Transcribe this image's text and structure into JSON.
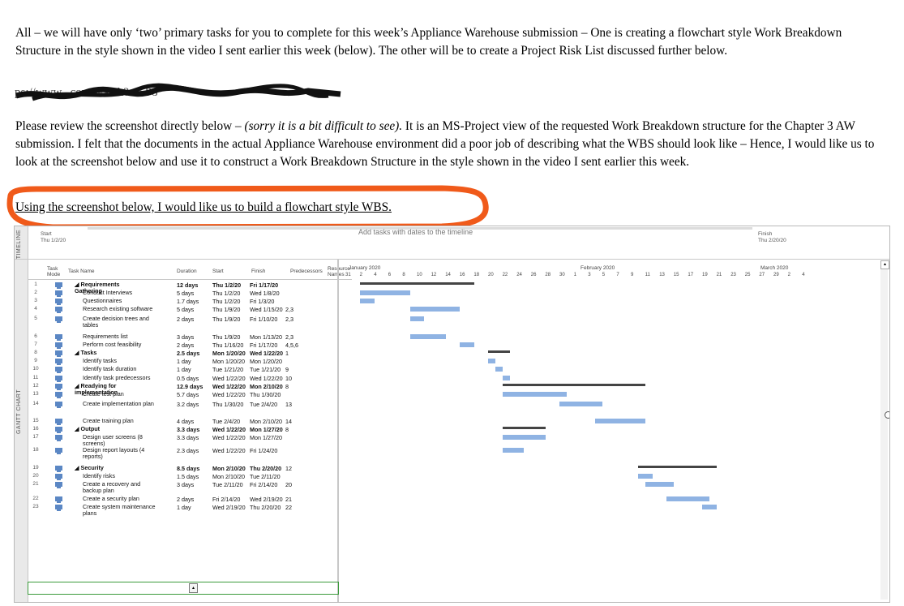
{
  "paragraphs": {
    "p1": "All – we will have only ‘two’ primary tasks for you to complete for this week’s Appliance Warehouse submission – One is creating a flowchart style Work Breakdown Structure in the style shown in the video I sent earlier this week (below).  The other will be to create a Project Risk List discussed further below.",
    "p2_a": "Please review the screenshot directly below – ",
    "p2_italic": "(sorry it is a bit difficult to see).",
    "p2_b": "  It is an MS-Project view of the requested Work Breakdown structure for the Chapter 3 AW submission.  I felt that the documents in the actual Appliance Warehouse environment did a poor job of describing what the WBS should look like – Hence, I would like us to look at the screenshot below and use it to construct a Work Breakdown Structure in the style shown in the video I sent earlier this week.",
    "p3": "Using the screenshot below, I would like us to build a flowchart style WBS.",
    "redacted_fragment": "ps://www.           .com/watch?v=        P8"
  },
  "project": {
    "timeline_tab": "TIMELINE",
    "gantt_tab": "GANTT CHART",
    "timeline_start_label": "Start",
    "timeline_start_date": "Thu 1/2/20",
    "timeline_finish_label": "Finish",
    "timeline_finish_date": "Thu 2/20/20",
    "timeline_message": "Add tasks with dates to the timeline",
    "headers": {
      "task_mode": "Task Mode",
      "task_name": "Task Name",
      "duration": "Duration",
      "start": "Start",
      "finish": "Finish",
      "predecessors": "Predecessors",
      "resource": "Resource Names"
    },
    "months": [
      "January 2020",
      "February 2020",
      "March 2020"
    ],
    "days": [
      "31",
      "2",
      "4",
      "6",
      "8",
      "10",
      "12",
      "14",
      "16",
      "18",
      "20",
      "22",
      "24",
      "26",
      "28",
      "30",
      "1",
      "3",
      "5",
      "7",
      "9",
      "11",
      "13",
      "15",
      "17",
      "19",
      "21",
      "23",
      "25",
      "27",
      "29",
      "2",
      "4"
    ],
    "rows": [
      {
        "id": "1",
        "name": "Requirements Gathering",
        "summary": true,
        "indent": 0,
        "duration": "12 days",
        "start": "Thu 1/2/20",
        "finish": "Fri 1/17/20",
        "pred": ""
      },
      {
        "id": "2",
        "name": "Conduct Interviews",
        "summary": false,
        "indent": 1,
        "duration": "5 days",
        "start": "Thu 1/2/20",
        "finish": "Wed 1/8/20",
        "pred": ""
      },
      {
        "id": "3",
        "name": "Questionnaires",
        "summary": false,
        "indent": 1,
        "duration": "1.7 days",
        "start": "Thu 1/2/20",
        "finish": "Fri 1/3/20",
        "pred": ""
      },
      {
        "id": "4",
        "name": "Research existing software",
        "summary": false,
        "indent": 1,
        "duration": "5 days",
        "start": "Thu 1/9/20",
        "finish": "Wed 1/15/20",
        "pred": "2,3"
      },
      {
        "id": "5",
        "name": "Create decision trees and tables",
        "summary": false,
        "indent": 1,
        "duration": "2 days",
        "start": "Thu 1/9/20",
        "finish": "Fri 1/10/20",
        "pred": "2,3"
      },
      {
        "id": "6",
        "name": "Requirements list",
        "summary": false,
        "indent": 1,
        "duration": "3 days",
        "start": "Thu 1/9/20",
        "finish": "Mon 1/13/20",
        "pred": "2,3"
      },
      {
        "id": "7",
        "name": "Perform cost feasibility",
        "summary": false,
        "indent": 1,
        "duration": "2 days",
        "start": "Thu 1/16/20",
        "finish": "Fri 1/17/20",
        "pred": "4,5,6"
      },
      {
        "id": "8",
        "name": "Tasks",
        "summary": true,
        "indent": 0,
        "duration": "2.5 days",
        "start": "Mon 1/20/20",
        "finish": "Wed 1/22/20",
        "pred": "1"
      },
      {
        "id": "9",
        "name": "Identify tasks",
        "summary": false,
        "indent": 1,
        "duration": "1 day",
        "start": "Mon 1/20/20",
        "finish": "Mon 1/20/20",
        "pred": ""
      },
      {
        "id": "10",
        "name": "Identify task duration",
        "summary": false,
        "indent": 1,
        "duration": "1 day",
        "start": "Tue 1/21/20",
        "finish": "Tue 1/21/20",
        "pred": "9"
      },
      {
        "id": "11",
        "name": "Identify task predecessors",
        "summary": false,
        "indent": 1,
        "duration": "0.5 days",
        "start": "Wed 1/22/20",
        "finish": "Wed 1/22/20",
        "pred": "10"
      },
      {
        "id": "12",
        "name": "Readying for implementation",
        "summary": true,
        "indent": 0,
        "duration": "12.9 days",
        "start": "Wed 1/22/20",
        "finish": "Mon 2/10/20",
        "pred": "8"
      },
      {
        "id": "13",
        "name": "Create test plan",
        "summary": false,
        "indent": 1,
        "duration": "5.7 days",
        "start": "Wed 1/22/20",
        "finish": "Thu 1/30/20",
        "pred": ""
      },
      {
        "id": "14",
        "name": "Create implementation plan",
        "summary": false,
        "indent": 1,
        "duration": "3.2 days",
        "start": "Thu 1/30/20",
        "finish": "Tue 2/4/20",
        "pred": "13"
      },
      {
        "id": "15",
        "name": "Create training plan",
        "summary": false,
        "indent": 1,
        "duration": "4 days",
        "start": "Tue 2/4/20",
        "finish": "Mon 2/10/20",
        "pred": "14"
      },
      {
        "id": "16",
        "name": "Output",
        "summary": true,
        "indent": 0,
        "duration": "3.3 days",
        "start": "Wed 1/22/20",
        "finish": "Mon 1/27/20",
        "pred": "8"
      },
      {
        "id": "17",
        "name": "Design user screens (8 screens)",
        "summary": false,
        "indent": 1,
        "duration": "3.3 days",
        "start": "Wed 1/22/20",
        "finish": "Mon 1/27/20",
        "pred": ""
      },
      {
        "id": "18",
        "name": "Design report layouts (4 reports)",
        "summary": false,
        "indent": 1,
        "duration": "2.3 days",
        "start": "Wed 1/22/20",
        "finish": "Fri 1/24/20",
        "pred": ""
      },
      {
        "id": "19",
        "name": "Security",
        "summary": true,
        "indent": 0,
        "duration": "8.5 days",
        "start": "Mon 2/10/20",
        "finish": "Thu 2/20/20",
        "pred": "12"
      },
      {
        "id": "20",
        "name": "Identify risks",
        "summary": false,
        "indent": 1,
        "duration": "1.5 days",
        "start": "Mon 2/10/20",
        "finish": "Tue 2/11/20",
        "pred": ""
      },
      {
        "id": "21",
        "name": "Create a recovery and backup plan",
        "summary": false,
        "indent": 1,
        "duration": "3 days",
        "start": "Tue 2/11/20",
        "finish": "Fri 2/14/20",
        "pred": "20"
      },
      {
        "id": "22",
        "name": "Create a security plan",
        "summary": false,
        "indent": 1,
        "duration": "2 days",
        "start": "Fri 2/14/20",
        "finish": "Wed 2/19/20",
        "pred": "21"
      },
      {
        "id": "23",
        "name": "Create system maintenance plans",
        "summary": false,
        "indent": 1,
        "duration": "1 day",
        "start": "Wed 2/19/20",
        "finish": "Thu 2/20/20",
        "pred": "22"
      }
    ],
    "colors": {
      "bar": "#8fb3e3",
      "summary": "#444444",
      "highlight": "#f05a1a"
    }
  }
}
